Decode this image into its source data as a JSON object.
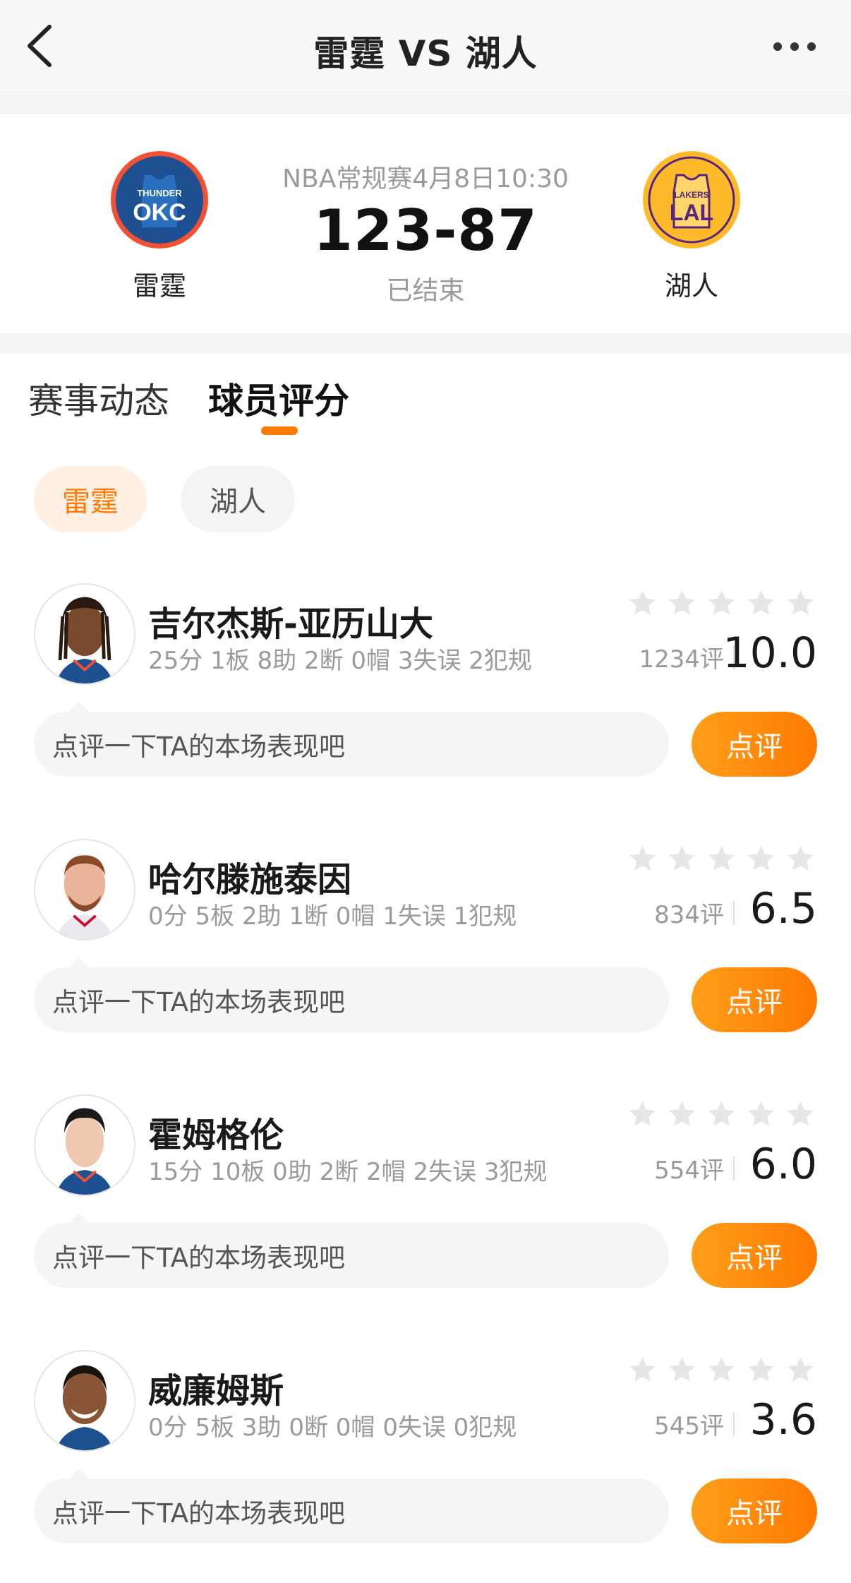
{
  "nav": {
    "title": "雷霆 VS 湖人"
  },
  "match": {
    "meta": "NBA常规赛4月8日10:30",
    "score": "123-87",
    "status": "已结束",
    "home": {
      "name": "雷霆",
      "logo_line1": "THUNDER",
      "logo_line2": "OKC",
      "color": "#1d4f91",
      "ring": "#f05133"
    },
    "away": {
      "name": "湖人",
      "logo_line1": "LAKERS",
      "logo_line2": "LAL",
      "color": "#552583",
      "ring": "#fdb927"
    }
  },
  "tabs": [
    "赛事动态",
    "球员评分"
  ],
  "team_filter": {
    "active": "雷霆",
    "inactive": "湖人"
  },
  "players": [
    {
      "name": "吉尔杰斯-亚历山大",
      "stats": "25分 1板 8助 2断 0帽 3失误 2犯规",
      "count": "1234评",
      "score": "10.0",
      "placeholder": "点评一下TA的本场表现吧",
      "button": "点评"
    },
    {
      "name": "哈尔滕施泰因",
      "stats": "0分 5板 2助 1断 0帽 1失误 1犯规",
      "count": "834评",
      "score": "6.5",
      "placeholder": "点评一下TA的本场表现吧",
      "button": "点评"
    },
    {
      "name": "霍姆格伦",
      "stats": "15分 10板 0助 2断 2帽 2失误 3犯规",
      "count": "554评",
      "score": "6.0",
      "placeholder": "点评一下TA的本场表现吧",
      "button": "点评"
    },
    {
      "name": "威廉姆斯",
      "stats": "0分 5板 3助 0断 0帽 0失误 0犯规",
      "count": "545评",
      "score": "3.6",
      "placeholder": "点评一下TA的本场表现吧",
      "button": "点评"
    }
  ],
  "accent": "#ff7a00"
}
